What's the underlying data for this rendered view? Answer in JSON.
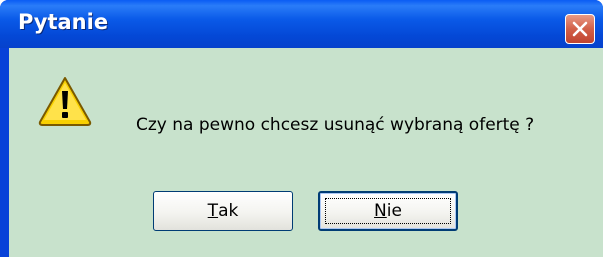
{
  "window": {
    "title": "Pytanie",
    "close_icon": "close-icon"
  },
  "dialog": {
    "icon": "warning-icon",
    "message": "Czy na pewno chcesz usunąć wybraną ofertę ?"
  },
  "buttons": {
    "yes": {
      "mnemonic": "T",
      "rest": "ak"
    },
    "no": {
      "mnemonic": "N",
      "rest": "ie"
    }
  },
  "colors": {
    "titlebar": "#0a5ae8",
    "client_bg": "#c8e2cc",
    "close_button": "#d26048",
    "warning_fill": "#f8d000"
  }
}
